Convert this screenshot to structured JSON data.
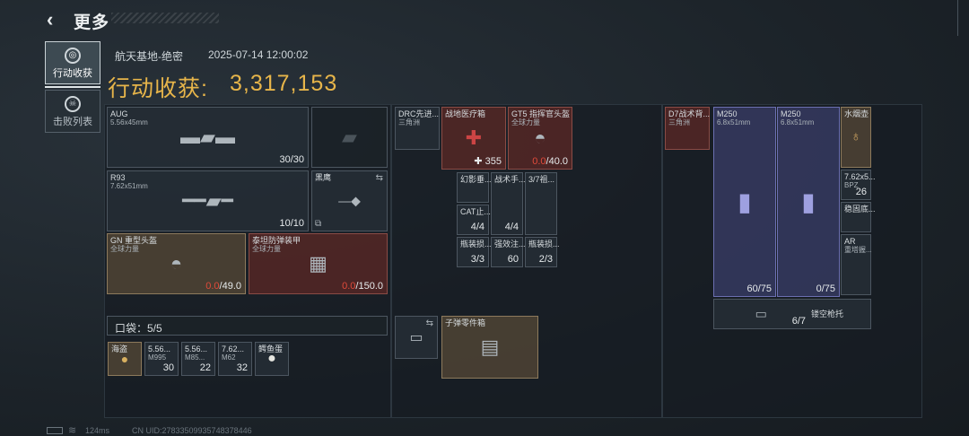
{
  "header": {
    "title": "更多",
    "back_icon": "back-arrow-icon"
  },
  "tabs": [
    {
      "label": "行动收获",
      "icon": "loot-icon",
      "active": true
    },
    {
      "label": "击败列表",
      "icon": "skull-icon",
      "active": false
    }
  ],
  "match": {
    "map": "航天基地-绝密",
    "time": "2025-07-14 12:00:02",
    "haul_label": "行动收获:",
    "haul_value": "3,317,153"
  },
  "gear": {
    "primary": {
      "name": "AUG",
      "ammo": "5.56x45mm",
      "count": "30/30"
    },
    "secondary": {
      "name": "R93",
      "ammo": "7.62x51mm",
      "count": "10/10"
    },
    "knife": {
      "name": "黑鹰"
    },
    "helmet": {
      "name": "GN 重型头盔",
      "brand": "全球力量",
      "dur_cur": "0.0",
      "dur_max": "/49.0"
    },
    "armor": {
      "name": "泰坦防弹装甲",
      "brand": "全球力量",
      "dur_cur": "0.0",
      "dur_max": "/150.0"
    }
  },
  "pocket": {
    "label": "口袋：5/5",
    "items": [
      {
        "name": "海盗",
        "count": ""
      },
      {
        "name": "5.56...",
        "sub": "M995",
        "count": "30"
      },
      {
        "name": "5.56...",
        "sub": "M85...",
        "count": "22"
      },
      {
        "name": "7.62...",
        "sub": "M62",
        "count": "32"
      },
      {
        "name": "鳄鱼蛋",
        "count": ""
      }
    ]
  },
  "chest": {
    "items": [
      {
        "name": "DRC先进...",
        "sub": "三角洲"
      },
      {
        "name": "战地医疗箱",
        "count": "355"
      },
      {
        "name": "GT5 指挥官头盔",
        "sub": "全球力量",
        "dur_cur": "0.0",
        "dur_max": "/40.0"
      },
      {
        "name": "幻影垂...",
        "count": ""
      },
      {
        "name": "战术手...",
        "count": "4/4"
      },
      {
        "name": "3/7祖...",
        "count": ""
      },
      {
        "name": "CAT止...",
        "count": "4/4"
      },
      {
        "name": "瓶装损...",
        "count": "3/3"
      },
      {
        "name": "强效注...",
        "count": "60"
      },
      {
        "name": "瓶装损...",
        "count": "2/3"
      }
    ]
  },
  "backpack": {
    "items": [
      {
        "name": "子弹零件箱"
      }
    ]
  },
  "right": {
    "items": [
      {
        "name": "D7战术背...",
        "sub": "三角洲"
      },
      {
        "name": "M250",
        "sub": "6.8x51mm",
        "count": "60/75"
      },
      {
        "name": "M250",
        "sub": "6.8x51mm",
        "count": "0/75"
      },
      {
        "name": "水烟壶",
        "count": ""
      },
      {
        "name": "7.62x5...",
        "sub": "BPZ",
        "count": "26"
      },
      {
        "name": "稳固底...",
        "count": ""
      },
      {
        "name": "AR",
        "sub": "重塔握...",
        "count": ""
      },
      {
        "name": "镂空枪托",
        "count": "6/7"
      }
    ]
  },
  "footer": {
    "ping": "124ms",
    "uid": "CN UID:278335099357483784​46"
  },
  "colors": {
    "accent": "#e7b54a",
    "broken": "#e04a3a"
  }
}
